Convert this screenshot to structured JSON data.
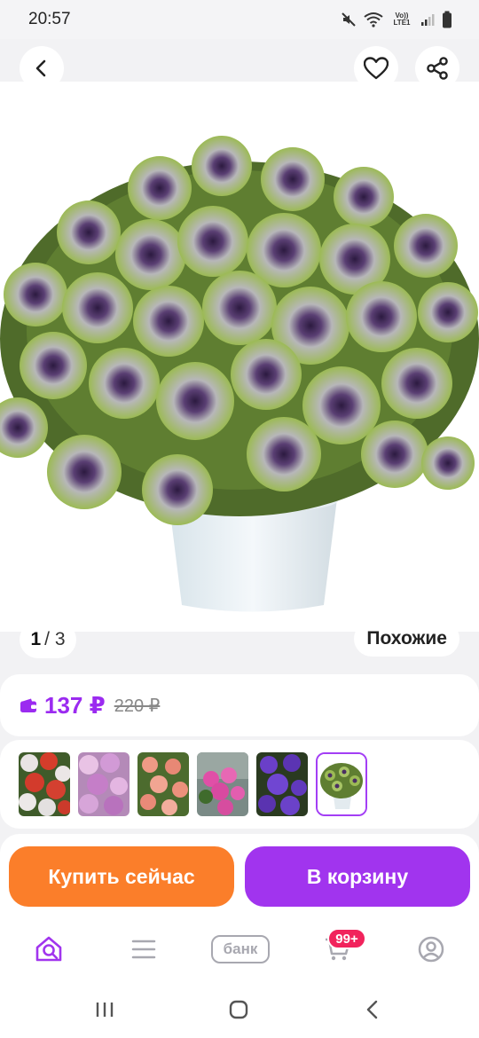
{
  "status_bar": {
    "time": "20:57",
    "network_label": "Vo)) LTE1",
    "icons": [
      "mute-icon",
      "wifi-icon",
      "signal-icon",
      "battery-icon"
    ]
  },
  "header": {
    "back_icon": "chevron-left-icon",
    "favorite_icon": "heart-icon",
    "share_icon": "share-icon"
  },
  "gallery": {
    "current_page": "1",
    "total_pages": "/ 3",
    "similar_label": "Похожие"
  },
  "price": {
    "wallet_icon": "wallet-icon",
    "current": "137 ₽",
    "old": "220 ₽",
    "accent_color": "#9b2bf0"
  },
  "thumbnails": [
    {
      "name": "red-white-petunias",
      "selected": false
    },
    {
      "name": "pink-petunias",
      "selected": false
    },
    {
      "name": "salmon-petunias",
      "selected": false
    },
    {
      "name": "pink-petunia-basket",
      "selected": false
    },
    {
      "name": "purple-petunias",
      "selected": false
    },
    {
      "name": "green-purple-petunia-pot",
      "selected": true
    }
  ],
  "actions": {
    "buy_now_label": "Купить сейчас",
    "buy_now_color": "#fb7e2a",
    "add_to_cart_label": "В корзину",
    "add_to_cart_color": "#a134ee"
  },
  "bottom_nav": {
    "items": [
      "home-search-icon",
      "catalog-icon",
      "bank-icon",
      "cart-icon",
      "profile-icon"
    ],
    "bank_label": "банк",
    "cart_badge": "99+"
  },
  "system_nav": [
    "recent-apps-icon",
    "home-icon",
    "back-icon"
  ]
}
